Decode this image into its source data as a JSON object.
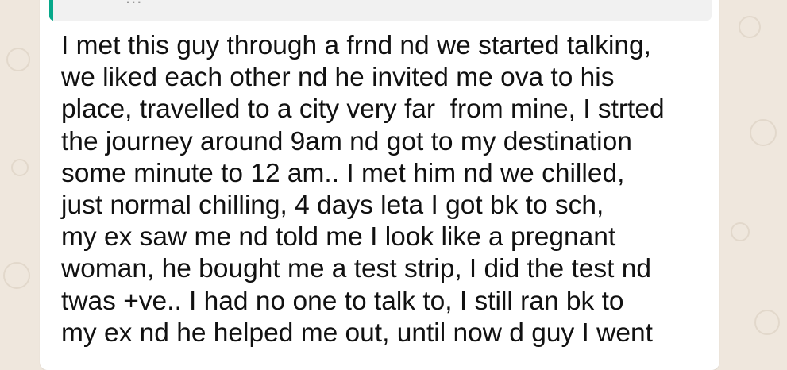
{
  "theme": {
    "wallpaper_color": "#efe7dd",
    "bubble_color": "#ffffff",
    "quote_accent": "#06a88a"
  },
  "quote": {
    "preview": "..."
  },
  "message": {
    "lines": [
      "I met this guy through a frnd nd we started talking,",
      "we liked each other nd he invited me ova to his",
      "place, travelled to a city very far  from mine, I strted",
      "the journey around 9am nd got to my destination",
      "some minute to 12 am.. I met him nd we chilled,",
      "just normal chilling, 4 days leta I got bk to sch,",
      "my ex saw me nd told me I look like a pregnant",
      "woman, he bought me a test strip, I did the test nd",
      "twas +ve.. I had no one to talk to, I still ran bk to",
      "my ex nd he helped me out, until now d guy I went"
    ]
  }
}
